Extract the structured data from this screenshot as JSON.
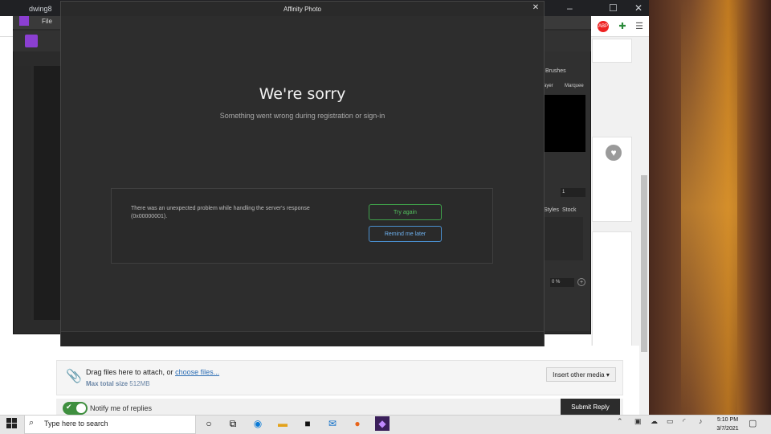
{
  "browser": {
    "tab_text": "dwing8",
    "window_controls": [
      "–",
      "☐",
      "✕"
    ]
  },
  "app": {
    "menu_file": "File",
    "panel": {
      "brushes_label": "Brushes",
      "layer_label": "ayer",
      "marquee_label": "Marquee",
      "value": "1",
      "styles_label": "Styles",
      "stock_label": "Stock",
      "percent": "0 %"
    }
  },
  "dialog": {
    "title": "Affinity Photo",
    "headline": "We're sorry",
    "subline": "Something went wrong during registration or sign-in",
    "error_message": "There was an unexpected problem while handling the server's response (0x00000001).",
    "try_again_label": "Try again",
    "remind_label": "Remind me later",
    "colors": {
      "try_again": "#54c25f",
      "remind": "#6db0ee",
      "background": "#2d2d2d"
    }
  },
  "page": {
    "attach_text": "Drag files here to attach, or ",
    "attach_link": "choose files...",
    "max_label": "Max total size",
    "max_value": "512MB",
    "insert_media": "Insert other media ▾",
    "notify_label": "Notify me of replies",
    "submit_label": "Submit Reply"
  },
  "taskbar": {
    "search_placeholder": "Type here to search",
    "time": "5:10 PM",
    "date": "3/7/2021",
    "apps": [
      "cortana-icon",
      "task-view-icon",
      "edge-icon",
      "file-explorer-icon",
      "store-icon",
      "mail-icon",
      "firefox-icon",
      "affinity-photo-icon"
    ]
  }
}
